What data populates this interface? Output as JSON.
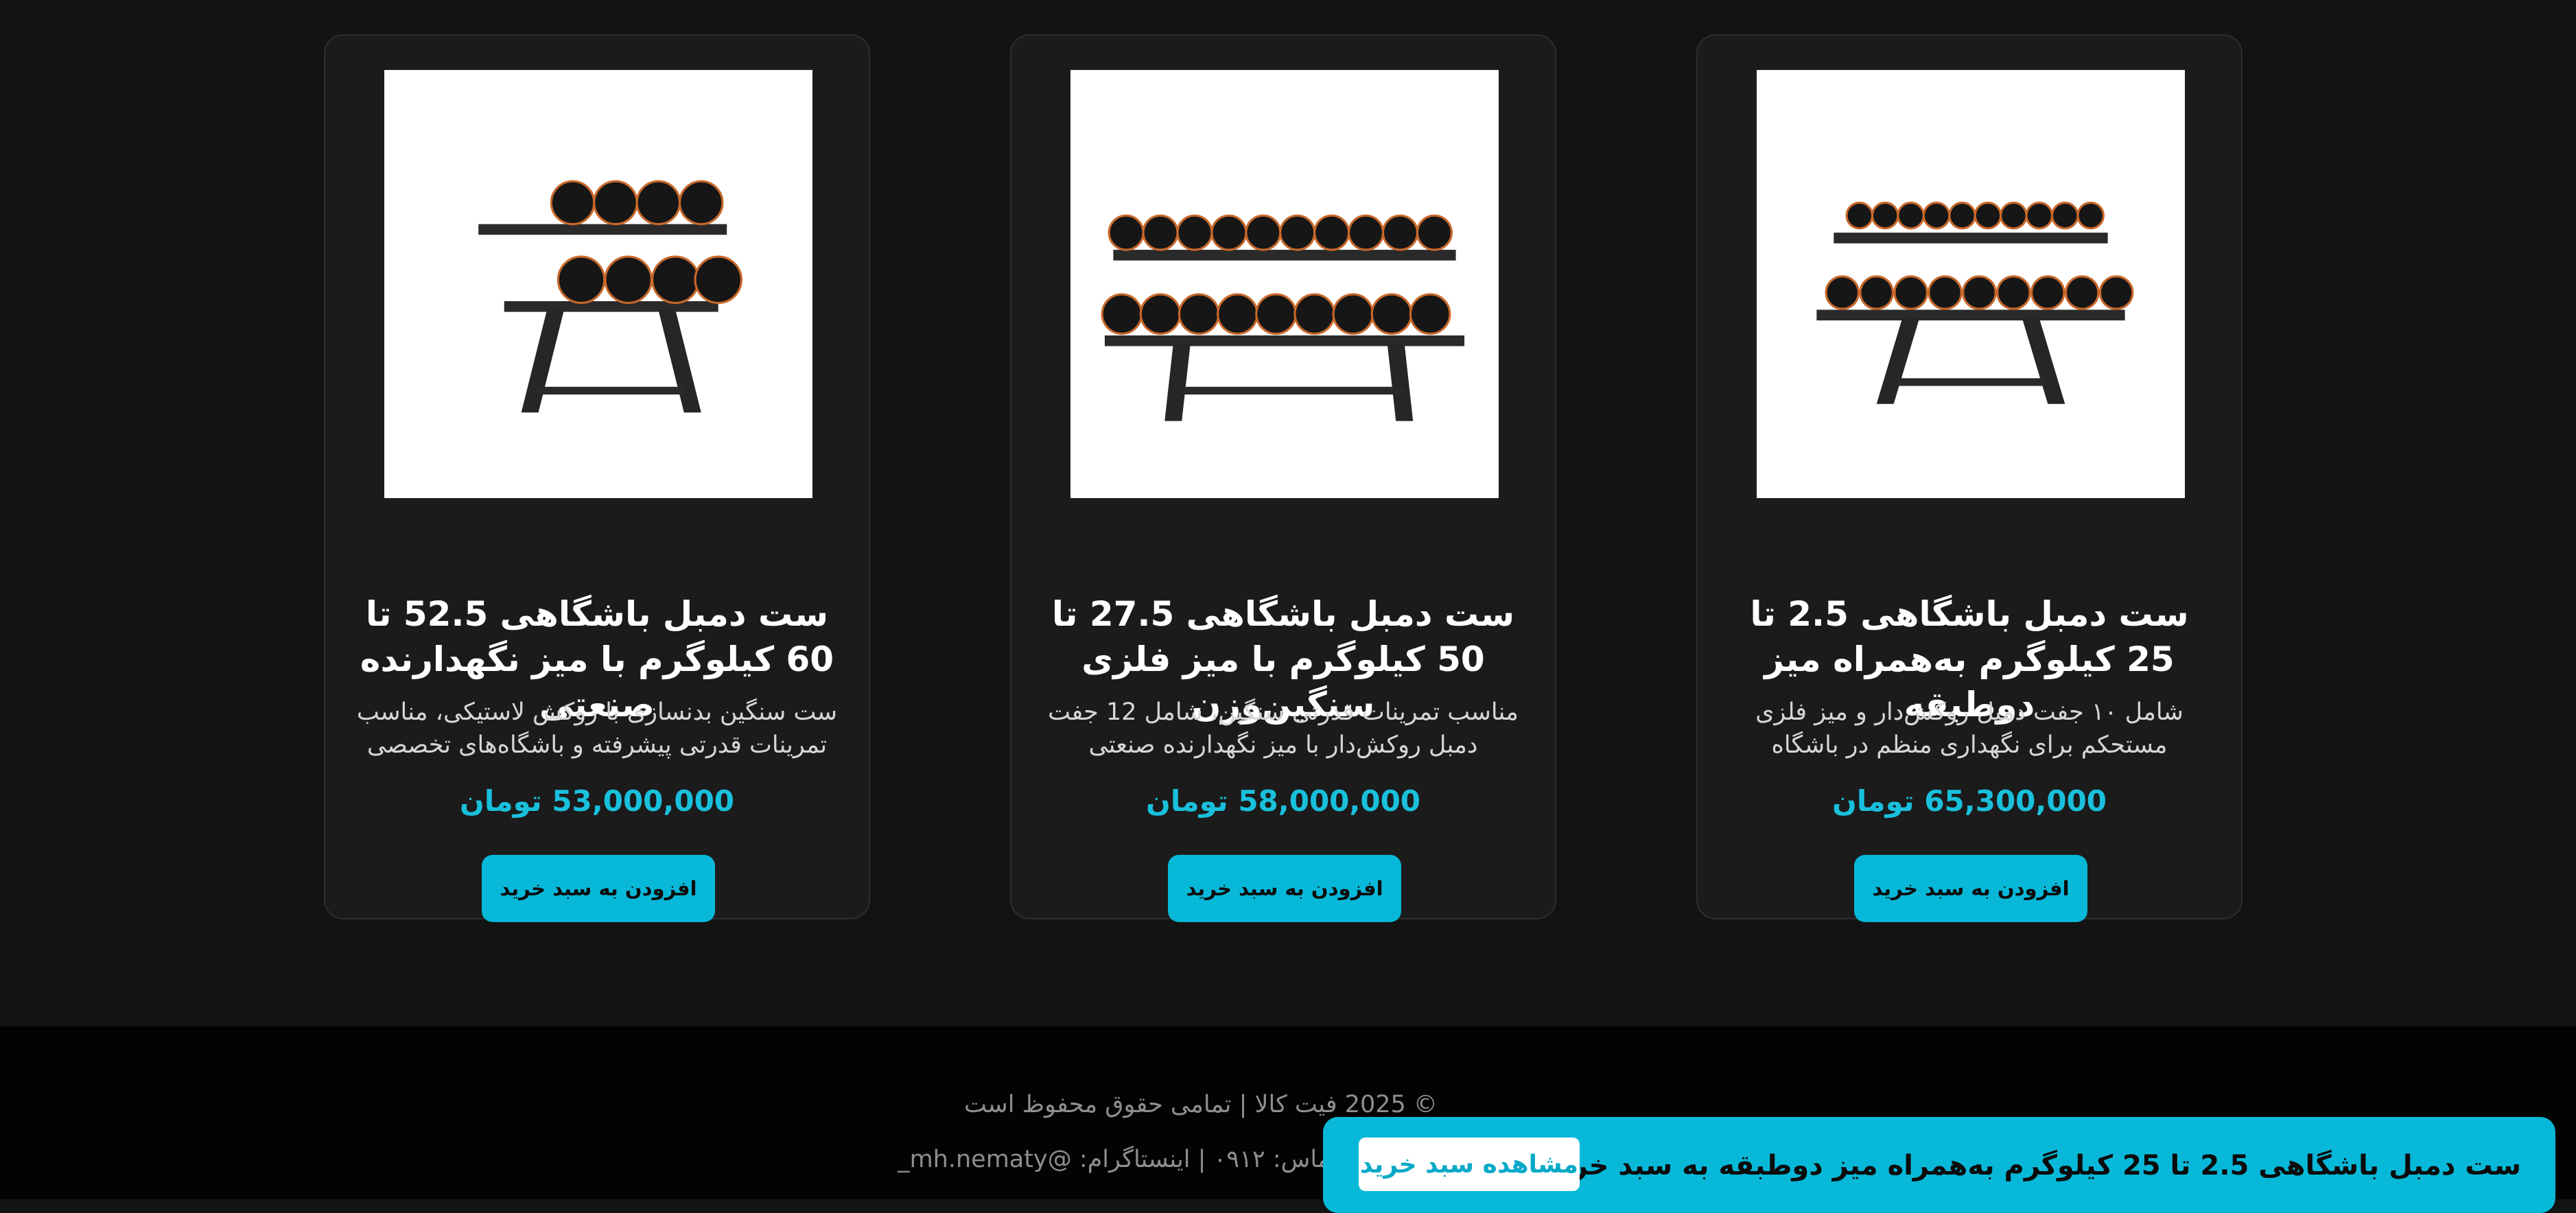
{
  "products": [
    {
      "title": "ست دمبل باشگاهی 2.5 تا 25 کیلوگرم به‌همراه میز دوطبقه",
      "description": "شامل ۱۰ جفت دمبل روکش‌دار و میز فلزی مستحکم برای نگهداری منظم در باشگاه",
      "price": "65,300,000 تومان",
      "button": "افزودن به سبد خرید",
      "image_icon": "dumbbell-rack-icon"
    },
    {
      "title": "ست دمبل باشگاهی 27.5 تا 50 کیلوگرم با میز فلزی سنگین‌وزن",
      "description": "مناسب تمرینات قدرتی سنگین، شامل 12 جفت دمبل روکش‌دار با میز نگهدارنده صنعتی",
      "price": "58,000,000 تومان",
      "button": "افزودن به سبد خرید",
      "image_icon": "dumbbell-rack-icon"
    },
    {
      "title": "ست دمبل باشگاهی 52.5 تا 60 کیلوگرم با میز نگهدارنده صنعتی",
      "description": "ست سنگین بدنسازی با روکش لاستیکی، مناسب تمرینات قدرتی پیشرفته و باشگاه‌های تخصصی",
      "price": "53,000,000 تومان",
      "button": "افزودن به سبد خرید",
      "image_icon": "dumbbell-rack-icon"
    }
  ],
  "footer": {
    "copyright": "© 2025 فیت کالا | تمامی حقوق محفوظ است",
    "social": "تماس: ۰۹۱۲ | اینستاگرام: @mh.nematy_"
  },
  "toast": {
    "message": "ست دمبل باشگاهی 2.5 تا 25 کیلوگرم به‌همراه میز دوطبقه به سبد خرید اضافه شد",
    "view_cart": "مشاهده سبد خرید"
  },
  "colors": {
    "accent": "#08b8d8",
    "price": "#19c0dc",
    "background": "#131313",
    "card": "#1b1b1b",
    "footer": "#030303"
  }
}
